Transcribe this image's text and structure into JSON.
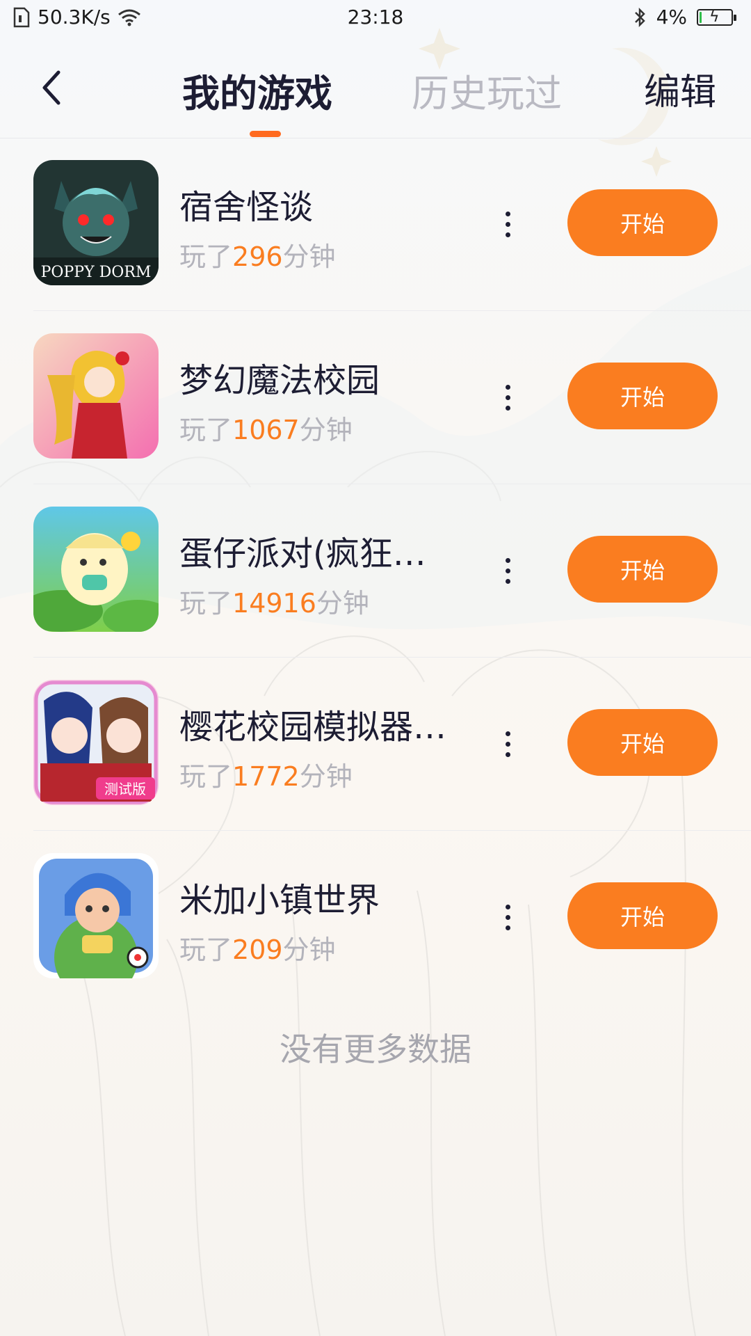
{
  "status_bar": {
    "network_speed": "50.3K/s",
    "time": "23:18",
    "battery": "4%",
    "battery_level": 0.04
  },
  "header": {
    "tabs": [
      {
        "label": "我的游戏",
        "active": true
      },
      {
        "label": "历史玩过",
        "active": false
      }
    ],
    "edit_label": "编辑"
  },
  "games": [
    {
      "name": "宿舍怪谈",
      "time_prefix": "玩了",
      "minutes": "296",
      "time_suffix": "分钟",
      "button": "开始",
      "icon": "poppy-dorm-icon",
      "icon_text": "POPPY DORM"
    },
    {
      "name": "梦幻魔法校园",
      "time_prefix": "玩了",
      "minutes": "1067",
      "time_suffix": "分钟",
      "button": "开始",
      "icon": "magic-school-icon"
    },
    {
      "name": "蛋仔派对(疯狂…",
      "time_prefix": "玩了",
      "minutes": "14916",
      "time_suffix": "分钟",
      "button": "开始",
      "icon": "eggy-party-icon"
    },
    {
      "name": "樱花校园模拟器…",
      "time_prefix": "玩了",
      "minutes": "1772",
      "time_suffix": "分钟",
      "button": "开始",
      "icon": "sakura-school-icon",
      "icon_text": "测试版"
    },
    {
      "name": "米加小镇世界",
      "time_prefix": "玩了",
      "minutes": "209",
      "time_suffix": "分钟",
      "button": "开始",
      "icon": "miga-town-icon"
    }
  ],
  "footer_text": "没有更多数据",
  "colors": {
    "accent": "#fa7d20",
    "title": "#1d1d33",
    "muted": "#b3b3bb"
  }
}
